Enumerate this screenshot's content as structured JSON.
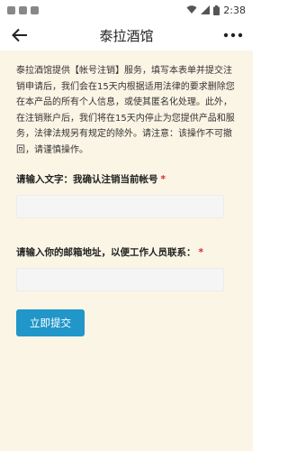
{
  "statusbar": {
    "time": "2:38"
  },
  "header": {
    "title": "泰拉酒馆"
  },
  "description": "泰拉酒馆提供【帐号注销】服务，填写本表单并提交注销申请后，我们会在15天内根据适用法律的要求删除您在本产品的所有个人信息，或使其匿名化处理。此外，在注销账户后，我们将在15天内停止为您提供产品和服务，法律法规另有规定的除外。请注意：该操作不可撤回，请谨慎操作。",
  "fields": {
    "confirm_label": "请输入文字：我确认注销当前帐号",
    "email_label": "请输入你的邮箱地址，以便工作人员联系：",
    "required_mark": "*"
  },
  "submit_label": "立即提交",
  "colors": {
    "accent": "#2196c9",
    "background": "#fbf5e6",
    "required": "#d9272e"
  }
}
